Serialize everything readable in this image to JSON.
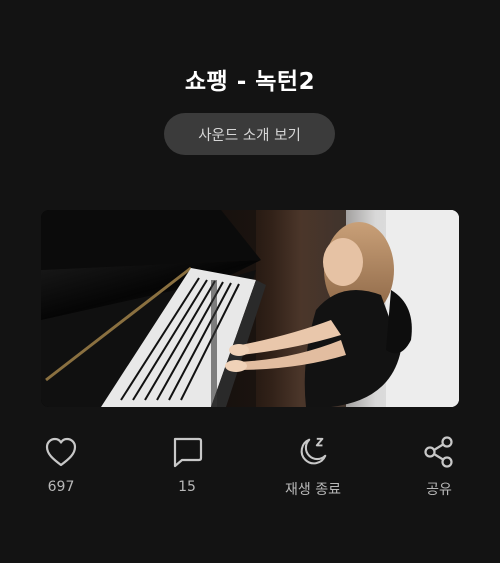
{
  "title": "쇼팽 - 녹턴2",
  "sound_button_label": "사운드 소개 보기",
  "video": {
    "description_icon": "piano-performance-thumbnail"
  },
  "actions": {
    "like": {
      "icon": "heart-icon",
      "label": "697"
    },
    "comment": {
      "icon": "comment-icon",
      "label": "15"
    },
    "sleep_timer": {
      "icon": "moon-sleep-icon",
      "label": "재생 종료"
    },
    "share": {
      "icon": "share-icon",
      "label": "공유"
    }
  },
  "colors": {
    "background": "#131313",
    "button_bg": "#3b3b3b",
    "text_primary": "#ffffff",
    "text_secondary": "#b8b8b8"
  }
}
